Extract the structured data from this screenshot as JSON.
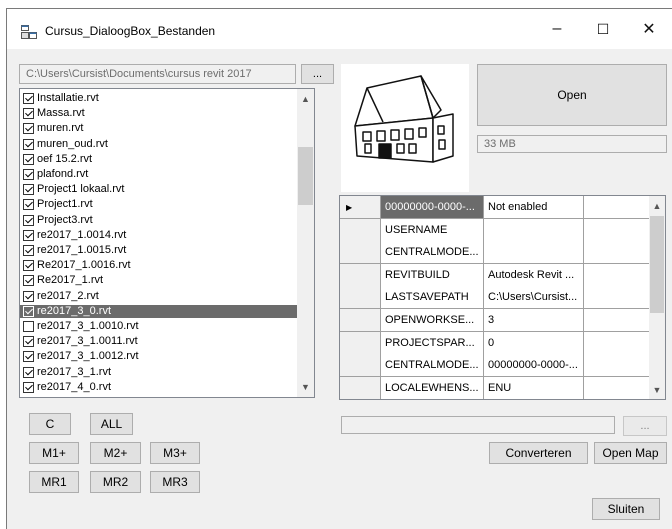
{
  "window": {
    "title": "Cursus_DialoogBox_Bestanden",
    "minimize": "–",
    "maximize": "☐",
    "close": "✕"
  },
  "path": {
    "value": "C:\\Users\\Cursist\\Documents\\cursus revit 2017",
    "browse_label": "..."
  },
  "files": [
    {
      "name": "Installatie.rvt",
      "checked": true
    },
    {
      "name": "Massa.rvt",
      "checked": true
    },
    {
      "name": "muren.rvt",
      "checked": true
    },
    {
      "name": "muren_oud.rvt",
      "checked": true
    },
    {
      "name": "oef 15.2.rvt",
      "checked": true
    },
    {
      "name": "plafond.rvt",
      "checked": true
    },
    {
      "name": "Project1 lokaal.rvt",
      "checked": true
    },
    {
      "name": "Project1.rvt",
      "checked": true
    },
    {
      "name": "Project3.rvt",
      "checked": true
    },
    {
      "name": "re2017_1.0014.rvt",
      "checked": true
    },
    {
      "name": "re2017_1.0015.rvt",
      "checked": true
    },
    {
      "name": "Re2017_1.0016.rvt",
      "checked": true
    },
    {
      "name": "Re2017_1.rvt",
      "checked": true
    },
    {
      "name": "re2017_2.rvt",
      "checked": true
    },
    {
      "name": "re2017_3_0.rvt",
      "checked": true,
      "selected": true
    },
    {
      "name": "re2017_3_1.0010.rvt",
      "checked": false
    },
    {
      "name": "re2017_3_1.0011.rvt",
      "checked": true
    },
    {
      "name": "re2017_3_1.0012.rvt",
      "checked": true
    },
    {
      "name": "re2017_3_1.rvt",
      "checked": true
    },
    {
      "name": "re2017_4_0.rvt",
      "checked": true
    }
  ],
  "buttons": {
    "open": "Open",
    "c": "C",
    "all": "ALL",
    "m1": "M1+",
    "m2": "M2+",
    "m3": "M3+",
    "mr1": "MR1",
    "mr2": "MR2",
    "mr3": "MR3",
    "converteren": "Converteren",
    "open_map": "Open Map",
    "sluiten": "Sluiten",
    "browse2": "..."
  },
  "size_text": "33 MB",
  "target_field": {
    "value": ""
  },
  "grid": {
    "rows": [
      {
        "key": "00000000-0000-...",
        "value": "Not enabled",
        "current": true
      },
      {
        "key": "USERNAME",
        "value": ""
      },
      {
        "key": "CENTRALMODE...",
        "value": ""
      },
      {
        "key": "REVITBUILD",
        "value": "Autodesk Revit ..."
      },
      {
        "key": "LASTSAVEPATH",
        "value": "C:\\Users\\Cursist..."
      },
      {
        "key": "OPENWORKSE...",
        "value": "3"
      },
      {
        "key": "PROJECTSPAR...",
        "value": "0"
      },
      {
        "key": "CENTRALMODE...",
        "value": "00000000-0000-..."
      },
      {
        "key": "LOCALEWHENS...",
        "value": "ENU"
      }
    ]
  },
  "icons": {
    "app": "app-window-icon",
    "preview": "house-preview-icon",
    "row_pointer": "row-pointer-icon"
  }
}
